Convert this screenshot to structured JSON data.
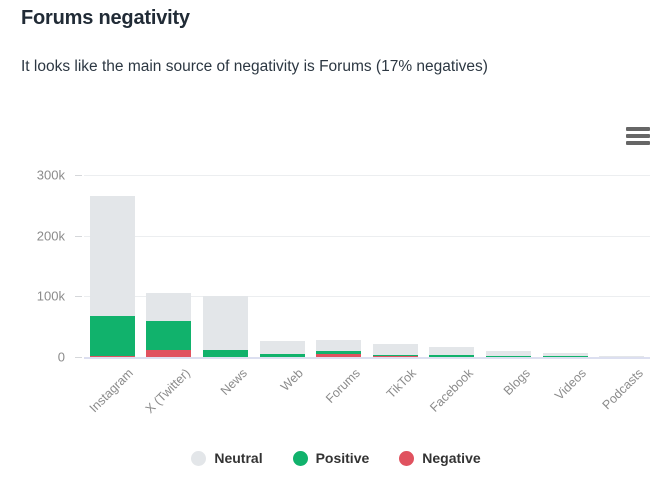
{
  "header": {
    "title": "Forums negativity",
    "subtitle": "It looks like the main source of negativity is Forums (17% negatives)"
  },
  "toolbar": {
    "menu_icon": "hamburger-menu-icon",
    "menu_label": "Chart context menu"
  },
  "chart_data": {
    "type": "bar",
    "stacked": true,
    "title": "Forums negativity",
    "subtitle": "It looks like the main source of negativity is Forums (17% negatives)",
    "xlabel": "",
    "ylabel": "",
    "ylim": [
      0,
      300000
    ],
    "yticks": [
      0,
      100000,
      200000,
      300000
    ],
    "ytick_labels": [
      "0",
      "100k",
      "200k",
      "300k"
    ],
    "grid": true,
    "legend_position": "bottom",
    "categories": [
      "Instagram",
      "X (Twitter)",
      "News",
      "Web",
      "Forums",
      "TikTok",
      "Facebook",
      "Blogs",
      "Videos",
      "Podcasts"
    ],
    "series": [
      {
        "name": "Negative",
        "color": "#e0525f",
        "values": [
          900,
          12000,
          600,
          700,
          4500,
          900,
          600,
          300,
          200,
          100
        ]
      },
      {
        "name": "Positive",
        "color": "#11b26c",
        "values": [
          66000,
          48000,
          10500,
          4500,
          5500,
          2500,
          3500,
          1200,
          700,
          200
        ]
      },
      {
        "name": "Neutral",
        "color": "#e3e6e9",
        "values": [
          199000,
          46000,
          90000,
          21000,
          18000,
          17500,
          12000,
          8500,
          5000,
          700
        ]
      }
    ],
    "totals": [
      265900,
      106000,
      101100,
      26200,
      28000,
      20900,
      16100,
      10000,
      5900,
      1000
    ]
  },
  "legend": [
    {
      "label": "Neutral",
      "color": "#e3e6e9"
    },
    {
      "label": "Positive",
      "color": "#11b26c"
    },
    {
      "label": "Negative",
      "color": "#e0525f"
    }
  ]
}
